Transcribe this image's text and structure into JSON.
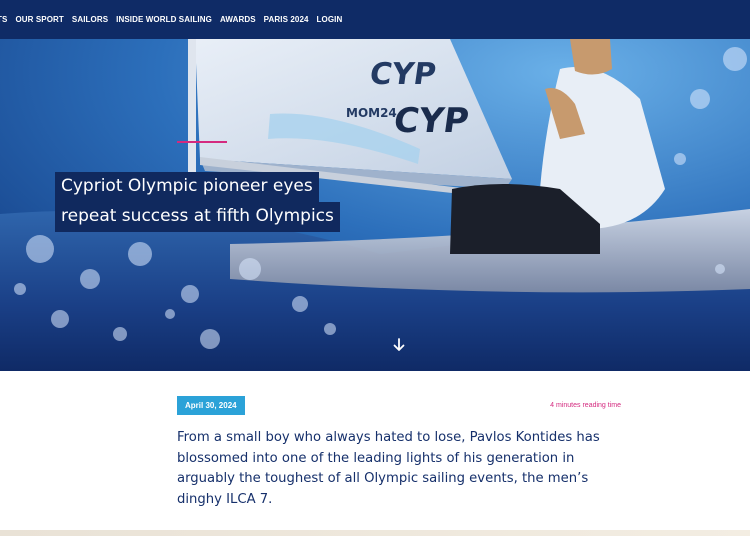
{
  "nav": {
    "items": [
      {
        "label": "TS"
      },
      {
        "label": "OUR SPORT"
      },
      {
        "label": "SAILORS"
      },
      {
        "label": "INSIDE WORLD SAILING"
      },
      {
        "label": "AWARDS"
      },
      {
        "label": "PARIS 2024"
      },
      {
        "label": "LOGIN"
      }
    ]
  },
  "hero": {
    "headline_line1": "Cypriot Olympic pioneer eyes",
    "headline_line2": "repeat success at fifth Olympics",
    "sail_text_1": "CYP",
    "sail_text_2": "CYP",
    "sail_class": "MOM24",
    "scroll_icon": "arrow-down-icon"
  },
  "article": {
    "date": "April 30, 2024",
    "reading_time": "4 minutes reading time",
    "intro": "From a small boy who always hated to lose, Pavlos Kontides has blossomed into one of the leading lights of his generation in arguably the toughest of all Olympic sailing events, the men’s dinghy ILCA 7."
  },
  "colors": {
    "nav_bg": "#0f2b66",
    "headline_bg": "#10295e",
    "date_badge": "#2ba2d8",
    "accent_pink": "#d42a7f",
    "body_text": "#16306b"
  }
}
